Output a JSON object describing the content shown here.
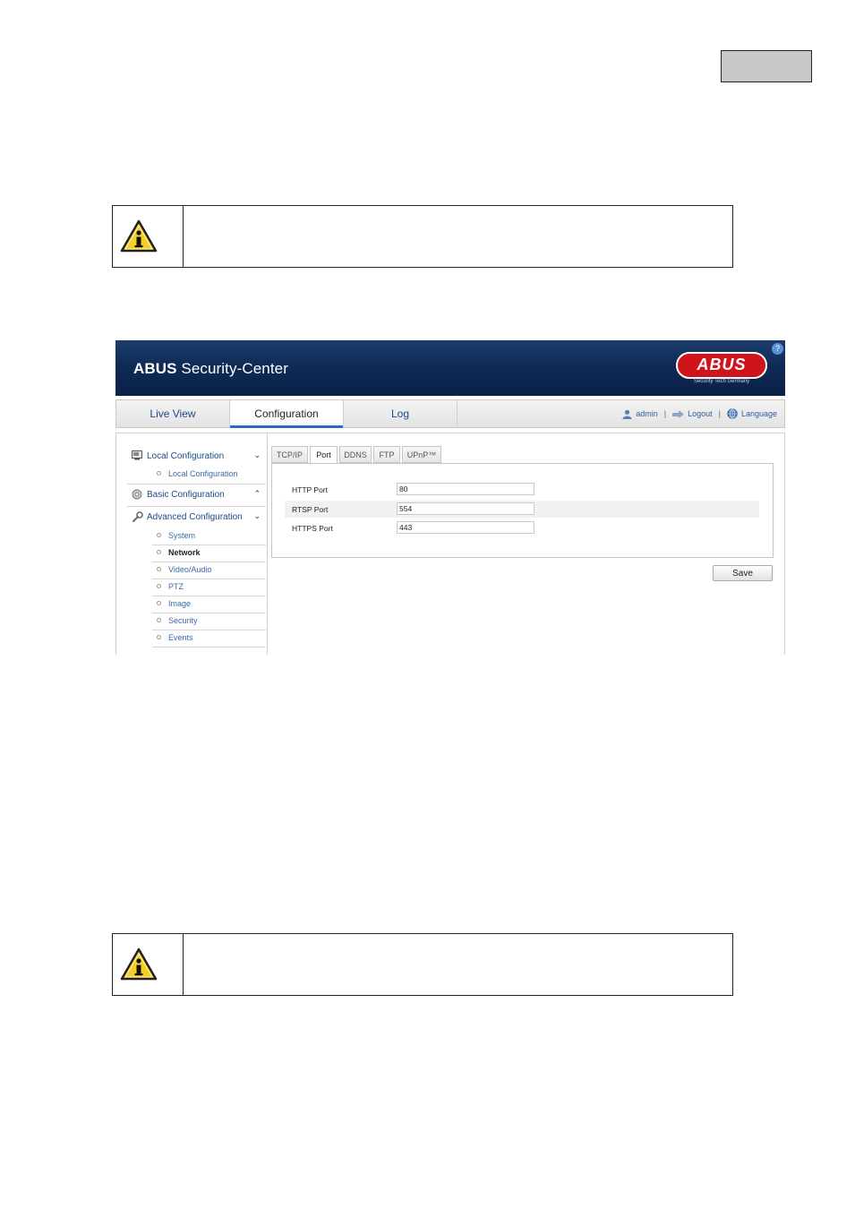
{
  "header": {
    "brand_bold": "ABUS",
    "brand_rest": " Security-Center"
  },
  "logo": {
    "text": "ABUS",
    "tagline": "Security Tech Germany"
  },
  "help": "?",
  "nav": {
    "tabs": [
      "Live View",
      "Configuration",
      "Log"
    ],
    "active": "Configuration",
    "user": "admin",
    "logout": "Logout",
    "language": "Language",
    "separator": "|"
  },
  "sidebar": {
    "local": {
      "label": "Local Configuration",
      "chevron": "⌄",
      "items": [
        "Local Configuration"
      ]
    },
    "basic": {
      "label": "Basic Configuration",
      "chevron": "⌃"
    },
    "advanced": {
      "label": "Advanced Configuration",
      "chevron": "⌄",
      "items": [
        "System",
        "Network",
        "Video/Audio",
        "PTZ",
        "Image",
        "Security",
        "Events"
      ],
      "active": "Network"
    }
  },
  "subtabs": [
    "TCP/IP",
    "Port",
    "DDNS",
    "FTP",
    "UPnP™"
  ],
  "active_subtab": "Port",
  "form": {
    "rows": [
      {
        "label": "HTTP Port",
        "value": "80"
      },
      {
        "label": "RTSP Port",
        "value": "554"
      },
      {
        "label": "HTTPS Port",
        "value": "443"
      }
    ],
    "save": "Save"
  },
  "icons": [
    "info-warning-icon",
    "user-icon",
    "logout-icon",
    "globe-icon",
    "local-config-icon",
    "basic-config-icon",
    "wrench-icon",
    "help-icon"
  ],
  "colors": {
    "banner": "#0f2b55",
    "brand_red": "#d0141c",
    "link_blue": "#1d4a86",
    "active_underline": "#2f6cb8"
  }
}
